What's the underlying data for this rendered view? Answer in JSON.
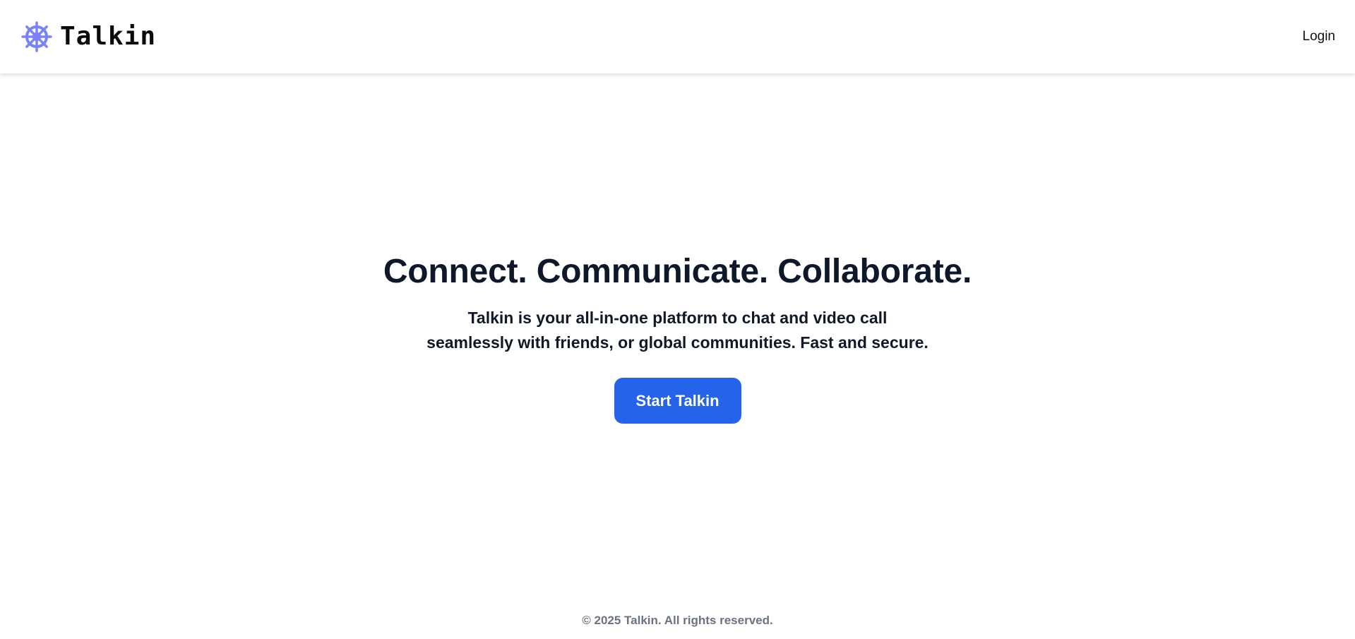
{
  "header": {
    "brand_name": "Talkin",
    "brand_icon": "ship-wheel-icon",
    "login_label": "Login"
  },
  "hero": {
    "title": "Connect. Communicate. Collaborate.",
    "subtitle": "Talkin is your all-in-one platform to chat and video call seamlessly with friends, or global communities. Fast and secure.",
    "cta_label": "Start Talkin"
  },
  "footer": {
    "copyright": "© 2025 Talkin. All rights reserved."
  },
  "colors": {
    "accent": "#2563eb",
    "logo": "#7b82f5",
    "heading": "#0f172a",
    "footer_text": "#6b7280"
  }
}
